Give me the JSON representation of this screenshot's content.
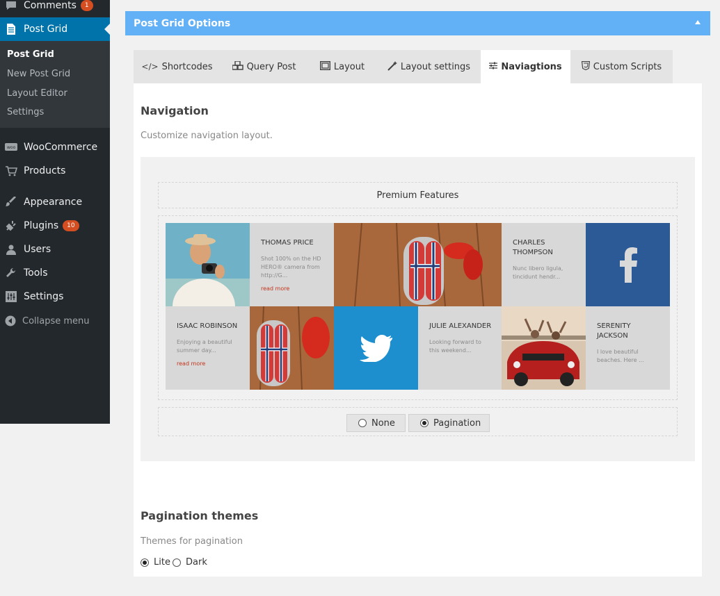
{
  "sidebar": {
    "top_items": [
      {
        "label": "Comments",
        "badge": "1",
        "icon": "comment-icon"
      },
      {
        "label": "Post Grid",
        "icon": "document-icon"
      }
    ],
    "submenu": [
      "Post Grid",
      "New Post Grid",
      "Layout Editor",
      "Settings"
    ],
    "items": [
      {
        "label": "WooCommerce",
        "icon": "woo-icon"
      },
      {
        "label": "Products",
        "icon": "cart-icon"
      },
      {
        "label": "Appearance",
        "icon": "brush-icon"
      },
      {
        "label": "Plugins",
        "badge": "10",
        "icon": "plugin-icon"
      },
      {
        "label": "Users",
        "icon": "user-icon"
      },
      {
        "label": "Tools",
        "icon": "wrench-icon"
      },
      {
        "label": "Settings",
        "icon": "sliders-icon"
      }
    ],
    "collapse_label": "Collapse menu"
  },
  "header": {
    "title": "Post Grid Options"
  },
  "tabs": [
    {
      "label": "Shortcodes",
      "icon": "</>"
    },
    {
      "label": "Query Post",
      "icon": "cubes-icon"
    },
    {
      "label": "Layout",
      "icon": "layout-icon"
    },
    {
      "label": "Layout settings",
      "icon": "magic-icon"
    },
    {
      "label": "Naviagtions",
      "icon": "sliders-icon"
    },
    {
      "label": "Custom Scripts",
      "icon": "css3-icon"
    }
  ],
  "navigation": {
    "title": "Navigation",
    "description": "Customize navigation layout.",
    "premium_label": "Premium Features",
    "posts": {
      "thomas": {
        "name": "THOMAS PRICE",
        "excerpt": "Shot 100% on the HD HERO® camera from http://G...",
        "more": "read more"
      },
      "charles": {
        "name": "CHARLES THOMPSON",
        "excerpt": "Nunc libero ligula, tincidunt hendr..."
      },
      "isaac": {
        "name": "ISAAC ROBINSON",
        "excerpt": "Enjoying a beautiful summer day...",
        "more": "read more"
      },
      "julie": {
        "name": "JULIE ALEXANDER",
        "excerpt": "Looking forward to this weekend..."
      },
      "serenity": {
        "name": "SERENITY JACKSON",
        "excerpt": "I love beautiful beaches. Here ..."
      }
    },
    "options": [
      {
        "label": "None",
        "checked": false
      },
      {
        "label": "Pagination",
        "checked": true
      }
    ]
  },
  "pagination_themes": {
    "title": "Pagination themes",
    "description": "Themes for pagination",
    "options": [
      {
        "label": "Lite",
        "checked": true
      },
      {
        "label": "Dark",
        "checked": false
      }
    ]
  },
  "colors": {
    "accent": "#0073aa",
    "header": "#62b0f5",
    "facebook": "#2c5a97",
    "twitter": "#1d8fcf"
  }
}
